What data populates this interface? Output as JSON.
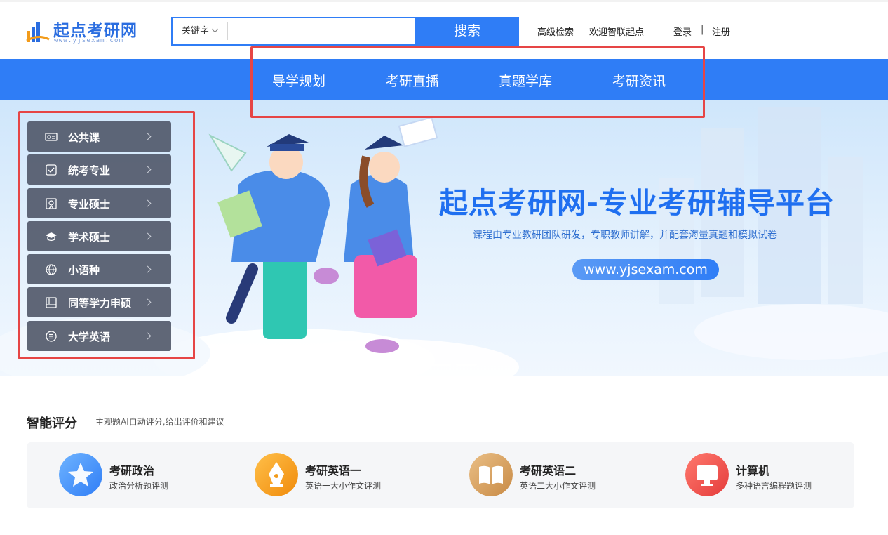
{
  "header": {
    "logo_text": "起点考研网",
    "logo_sub": "www.yjsexam.com",
    "search": {
      "category": "关键字",
      "placeholder": "",
      "button": "搜索"
    },
    "links": {
      "advanced": "高级检索",
      "welcome": "欢迎智联起点",
      "login": "登录",
      "separator": "|",
      "register": "注册"
    }
  },
  "nav": {
    "items": [
      "导学规划",
      "考研直播",
      "真题学库",
      "考研资讯"
    ]
  },
  "banner": {
    "title": "起点考研网-专业考研辅导平台",
    "subtitle": "课程由专业教研团队研发，专职教师讲解，并配套海量真题和模拟试卷",
    "url": "www.yjsexam.com",
    "slides": 3,
    "active_slide": 1
  },
  "categories": [
    {
      "label": "公共课",
      "icon": "id-card-icon"
    },
    {
      "label": "统考专业",
      "icon": "checkbox-icon"
    },
    {
      "label": "专业硕士",
      "icon": "certificate-icon"
    },
    {
      "label": "学术硕士",
      "icon": "graduation-cap-icon"
    },
    {
      "label": "小语种",
      "icon": "globe-icon"
    },
    {
      "label": "同等学力申硕",
      "icon": "book-icon"
    },
    {
      "label": "大学英语",
      "icon": "list-circle-icon"
    }
  ],
  "scoring": {
    "title": "智能评分",
    "subtitle": "主观题AI自动评分,给出评价和建议",
    "cards": [
      {
        "title": "考研政治",
        "desc": "政治分析题评测",
        "icon": "star-icon",
        "color": "#3d8bf0"
      },
      {
        "title": "考研英语一",
        "desc": "英语一大小作文评测",
        "icon": "pen-nib-icon",
        "color": "#f59a14"
      },
      {
        "title": "考研英语二",
        "desc": "英语二大小作文评测",
        "icon": "open-book-icon",
        "color": "#d29a57"
      },
      {
        "title": "计算机",
        "desc": "多种语言编程题评测",
        "icon": "monitor-icon",
        "color": "#ee4545"
      }
    ]
  },
  "colors": {
    "primary": "#2f7df6",
    "highlight": "#e64545",
    "menu_bg": "#4b5264"
  }
}
